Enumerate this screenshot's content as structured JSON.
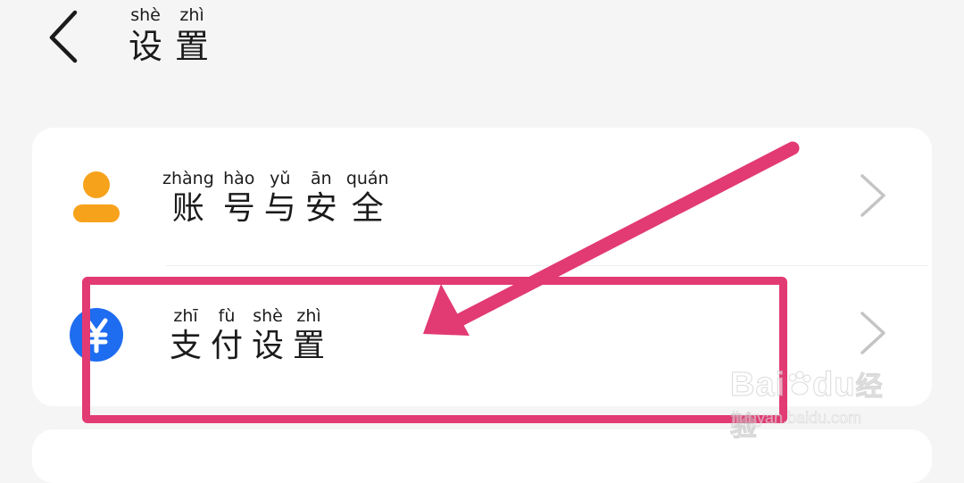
{
  "header": {
    "back_icon": "chevron-left-icon",
    "title": [
      {
        "pinyin": "shè",
        "hanzi": "设"
      },
      {
        "pinyin": "zhì",
        "hanzi": "置"
      }
    ]
  },
  "menu": {
    "items": [
      {
        "id": "account-security",
        "icon": "user-icon",
        "icon_color": "#f7a21b",
        "label": [
          {
            "pinyin": "zhàng",
            "hanzi": "账"
          },
          {
            "pinyin": "hào",
            "hanzi": "号"
          },
          {
            "pinyin": "yǔ",
            "hanzi": "与"
          },
          {
            "pinyin": "ān",
            "hanzi": "安"
          },
          {
            "pinyin": "quán",
            "hanzi": "全"
          }
        ]
      },
      {
        "id": "pay-settings",
        "icon": "yuan-icon",
        "icon_color": "#1e6cf0",
        "label": [
          {
            "pinyin": "zhī",
            "hanzi": "支"
          },
          {
            "pinyin": "fù",
            "hanzi": "付"
          },
          {
            "pinyin": "shè",
            "hanzi": "设"
          },
          {
            "pinyin": "zhì",
            "hanzi": "置"
          }
        ]
      }
    ]
  },
  "annotation": {
    "color": "#e23a72"
  },
  "watermark": {
    "brand": "Bai",
    "brand2": "du",
    "brand3": "经验",
    "url": "jingyan.baidu.com"
  }
}
